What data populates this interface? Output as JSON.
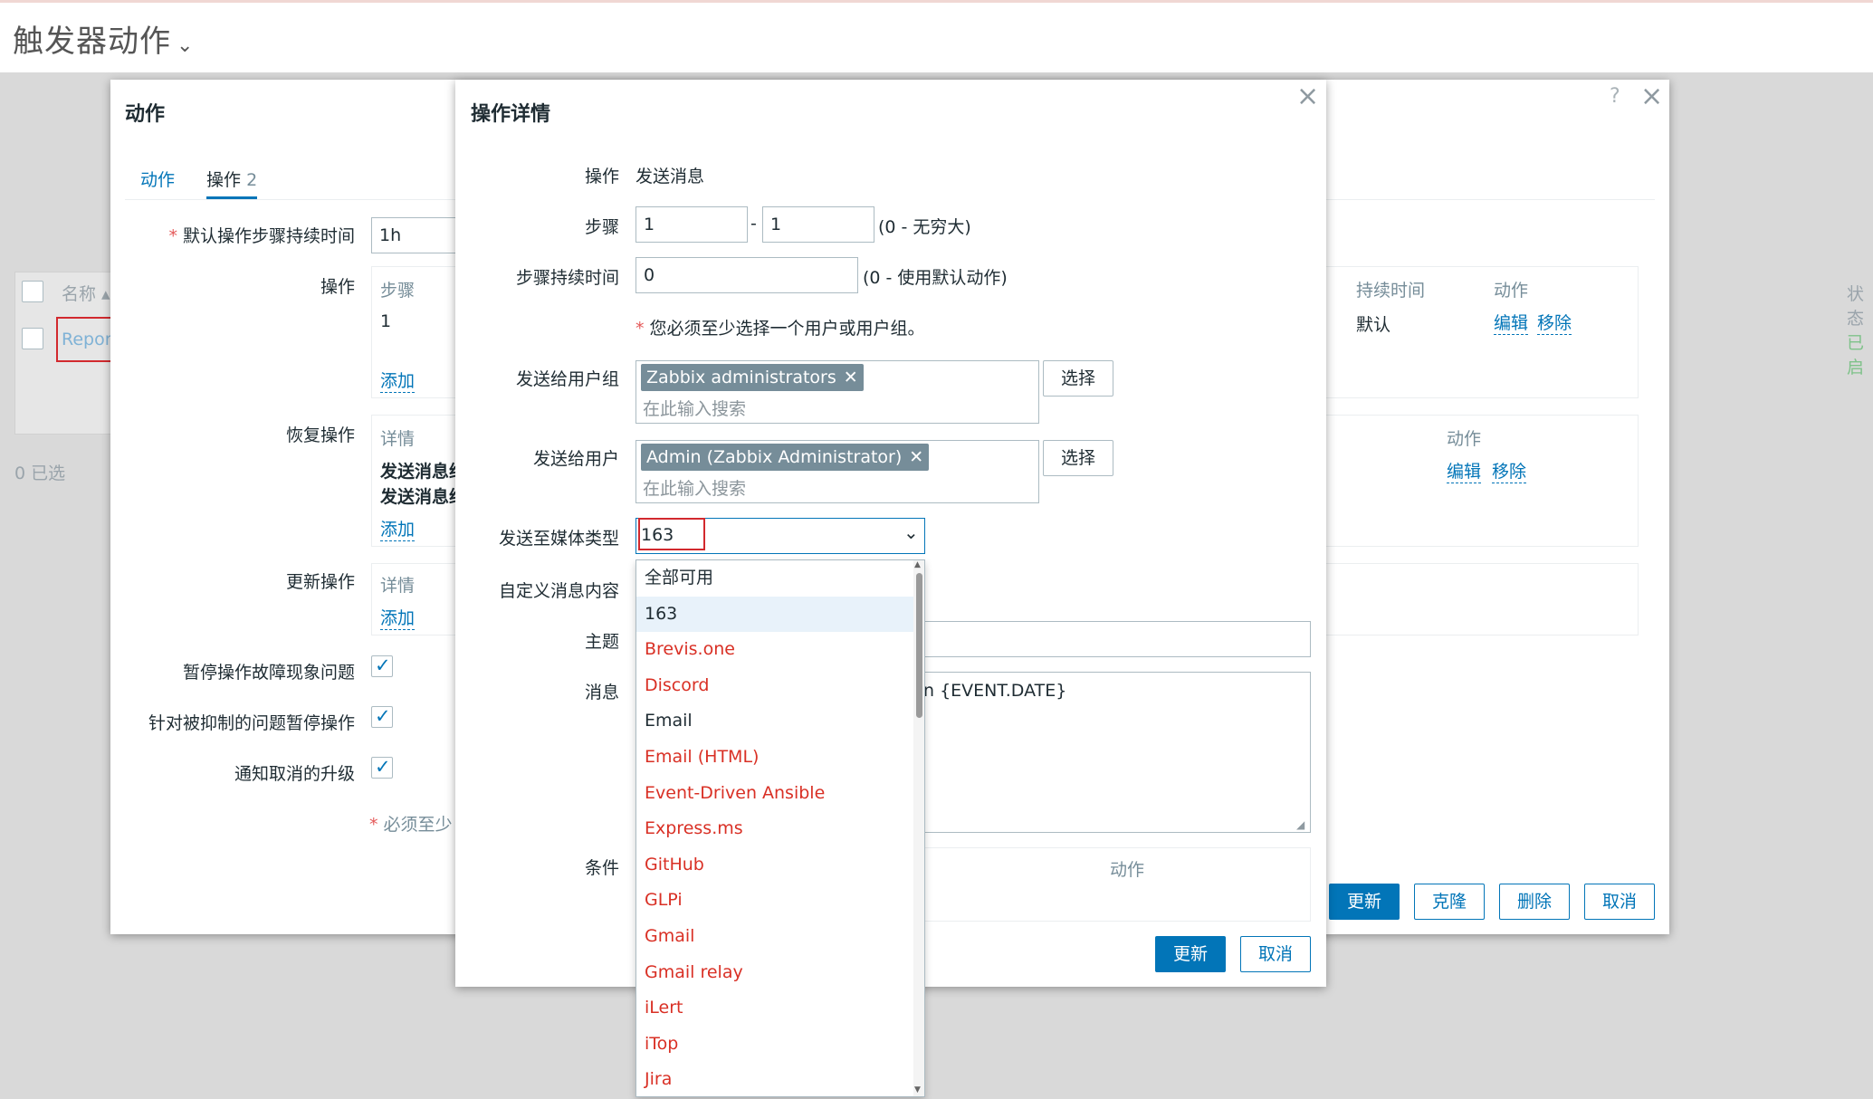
{
  "page": {
    "title": "触发器动作"
  },
  "bg_list": {
    "col_name": "名称 ▴",
    "row_name": "Repor",
    "selected_count": "0 已选",
    "col_status_clip": "状态",
    "row_status_clip": "已启",
    "row_status_color": "#3aa94c"
  },
  "action_dialog": {
    "title": "动作",
    "tabs": [
      {
        "label": "动作"
      },
      {
        "label": "操作",
        "badge": "2"
      }
    ],
    "default_step_duration_label": "默认操作步骤持续时间",
    "default_step_duration_value": "1h",
    "operations_label": "操作",
    "operations_headers": {
      "steps": "步骤",
      "duration": "持续时间",
      "action": "动作"
    },
    "operations_row": {
      "steps": "1",
      "duration": "默认",
      "edit": "编辑",
      "remove": "移除"
    },
    "add": "添加",
    "recovery_label": "恢复操作",
    "recovery_header_details": "详情",
    "recovery_header_action": "动作",
    "recovery_rows": [
      "发送消息给",
      "发送消息给"
    ],
    "recovery_edit": "编辑",
    "recovery_remove": "移除",
    "update_ops_label": "更新操作",
    "update_header_details": "详情",
    "pause_symptoms_label": "暂停操作故障现象问题",
    "pause_suppressed_label": "针对被抑制的问题暂停操作",
    "notify_cancelled_label": "通知取消的升级",
    "required_note": "必须至少",
    "buttons": {
      "update": "更新",
      "clone": "克隆",
      "delete": "删除",
      "cancel": "取消"
    },
    "help": "?"
  },
  "operation_dialog": {
    "title": "操作详情",
    "operation_label": "操作",
    "operation_value": "发送消息",
    "steps_label": "步骤",
    "steps_from": "1",
    "steps_dash": "-",
    "steps_to": "1",
    "steps_hint": "(0 - 无穷大)",
    "step_duration_label": "步骤持续时间",
    "step_duration_value": "0",
    "step_duration_hint": "(0 - 使用默认动作)",
    "must_select_note": "您必须至少选择一个用户或用户组。",
    "user_groups_label": "发送给用户组",
    "user_group_tag": "Zabbix administrators",
    "search_placeholder": "在此输入搜索",
    "select_button": "选择",
    "users_label": "发送给用户",
    "user_tag": "Admin (Zabbix Administrator)",
    "media_type_label": "发送至媒体类型",
    "media_type_value": "163",
    "custom_message_label": "自定义消息内容",
    "subject_label": "主题",
    "message_label": "消息",
    "message_visible": "n {EVENT.DATE}",
    "conditions_label": "条件",
    "conditions_header_action": "动作",
    "update_button": "更新",
    "cancel_button": "取消",
    "dropdown_options": [
      {
        "label": "全部可用",
        "red": false
      },
      {
        "label": "163",
        "red": false,
        "selected": true
      },
      {
        "label": "Brevis.one",
        "red": true
      },
      {
        "label": "Discord",
        "red": true
      },
      {
        "label": "Email",
        "red": false
      },
      {
        "label": "Email (HTML)",
        "red": true
      },
      {
        "label": "Event-Driven Ansible",
        "red": true
      },
      {
        "label": "Express.ms",
        "red": true
      },
      {
        "label": "GitHub",
        "red": true
      },
      {
        "label": "GLPi",
        "red": true
      },
      {
        "label": "Gmail",
        "red": true
      },
      {
        "label": "Gmail relay",
        "red": true
      },
      {
        "label": "iLert",
        "red": true
      },
      {
        "label": "iTop",
        "red": true
      },
      {
        "label": "Jira",
        "red": true
      }
    ]
  },
  "colors": {
    "accent": "#0275b8",
    "disabled_media": "#d93025",
    "highlight_box": "#d2292e"
  }
}
